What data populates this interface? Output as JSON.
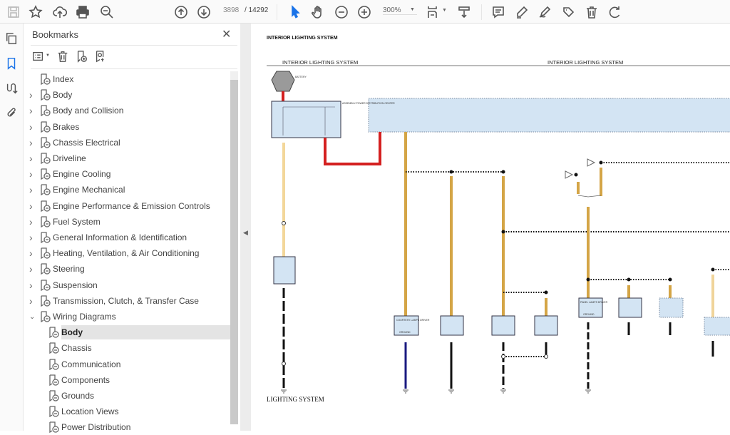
{
  "toolbar": {
    "icons": [
      "save-icon",
      "bookmark-star-icon",
      "upload-icon",
      "print-icon",
      "zoom-out-search-icon",
      "page-up-icon",
      "page-down-icon",
      "select-arrow-icon",
      "hand-icon",
      "zoom-out-icon",
      "zoom-in-icon",
      "fit-page-icon",
      "scroll-mode-icon",
      "comment-icon",
      "highlight-icon",
      "sign-icon",
      "stamp-icon",
      "delete-icon",
      "rotate-icon"
    ],
    "current_page": "3898",
    "page_total": "/  14292",
    "zoom": "300%",
    "accent_color": "#1a73e8"
  },
  "rail": {
    "icons": [
      "pages-icon",
      "bookmarks-icon",
      "signatures-icon",
      "attachments-icon"
    ]
  },
  "bookmarks": {
    "title": "Bookmarks",
    "items": [
      {
        "label": "Index",
        "level": 0,
        "expand": ""
      },
      {
        "label": "Body",
        "level": 0,
        "expand": "collapsed"
      },
      {
        "label": "Body and Collision",
        "level": 0,
        "expand": "collapsed"
      },
      {
        "label": "Brakes",
        "level": 0,
        "expand": "collapsed"
      },
      {
        "label": "Chassis Electrical",
        "level": 0,
        "expand": "collapsed"
      },
      {
        "label": "Driveline",
        "level": 0,
        "expand": "collapsed"
      },
      {
        "label": "Engine Cooling",
        "level": 0,
        "expand": "collapsed"
      },
      {
        "label": "Engine Mechanical",
        "level": 0,
        "expand": "collapsed"
      },
      {
        "label": "Engine Performance & Emission Controls",
        "level": 0,
        "expand": "collapsed"
      },
      {
        "label": "Fuel System",
        "level": 0,
        "expand": "collapsed"
      },
      {
        "label": "General Information & Identification",
        "level": 0,
        "expand": "collapsed"
      },
      {
        "label": "Heating, Ventilation, & Air Conditioning",
        "level": 0,
        "expand": "collapsed"
      },
      {
        "label": "Steering",
        "level": 0,
        "expand": "collapsed"
      },
      {
        "label": "Suspension",
        "level": 0,
        "expand": "collapsed"
      },
      {
        "label": "Transmission, Clutch, & Transfer Case",
        "level": 0,
        "expand": "collapsed"
      },
      {
        "label": "Wiring Diagrams",
        "level": 0,
        "expand": "expanded"
      },
      {
        "label": "Body",
        "level": 1,
        "expand": "",
        "selected": true
      },
      {
        "label": "Chassis",
        "level": 1,
        "expand": ""
      },
      {
        "label": "Communication",
        "level": 1,
        "expand": ""
      },
      {
        "label": "Components",
        "level": 1,
        "expand": ""
      },
      {
        "label": "Grounds",
        "level": 1,
        "expand": ""
      },
      {
        "label": "Location Views",
        "level": 1,
        "expand": ""
      },
      {
        "label": "Power Distribution",
        "level": 1,
        "expand": ""
      }
    ]
  },
  "document": {
    "page_title": "INTERIOR LIGHTING SYSTEM",
    "header_left": "INTERIOR LIGHTING SYSTEM",
    "header_right": "INTERIOR LIGHTING SYSTEM",
    "footer": "LIGHTING SYSTEM",
    "labels": {
      "battery": "BATTERY",
      "pdc": "ASSEMBLY-POWER DISTRIBUTION CENTER",
      "driver": "COURTESY LAMPS DRIVER",
      "panel_driver": "PANEL LAMPS DRIVER",
      "ground": "GROUND"
    },
    "wire_colors": {
      "red": "#d42020",
      "pale_yellow": "#f3d79a",
      "tan": "#d4a546",
      "black": "#111111",
      "navy": "#1a1a80",
      "box_fill": "#d3e4f3"
    }
  }
}
